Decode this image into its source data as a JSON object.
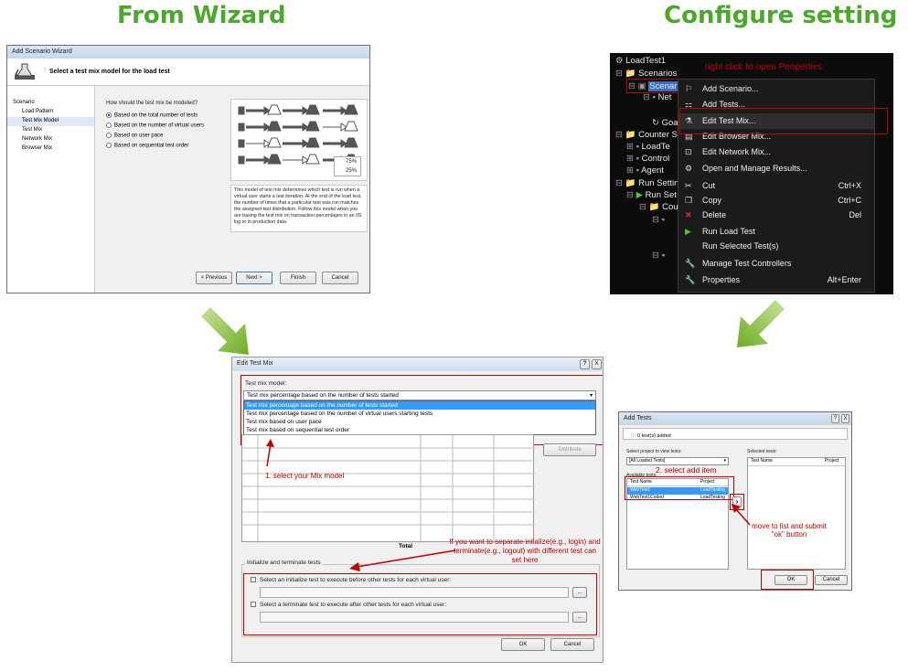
{
  "headings": {
    "left": "From Wizard",
    "right": "Configure setting"
  },
  "wizard": {
    "title": "Add Scenario Wizard",
    "header": "Select a test mix model for the load test",
    "nav": [
      "Scenario",
      "Load Pattern",
      "Test Mix Model",
      "Test Mix",
      "Network Mix",
      "Browser Mix"
    ],
    "selected_nav": "Test Mix Model",
    "question": "How should the test mix be modeled?",
    "options": [
      "Based on the total number of tests",
      "Based on the number of virtual users",
      "Based on user pace",
      "Based on sequential test order"
    ],
    "selected_option": "Based on the total number of tests",
    "legend": [
      "75%",
      "25%"
    ],
    "description": "This model of test mix determines which test is run when a virtual user starts a test iteration. At the end of the load test, the number of times that a particular test was run matches the assigned test distribution. Follow this model when you are basing the test mix on transaction percentages in an IIS log or in production data.",
    "buttons": {
      "previous": "< Previous",
      "next": "Next >",
      "finish": "Finish",
      "cancel": "Cancel"
    }
  },
  "context_panel": {
    "tree": {
      "root": "LoadTest1",
      "scenarios": "Scenarios",
      "scenario": "Scenario",
      "net": "Net",
      "goa": "Goa",
      "counter": "Counter Se",
      "loadte": "LoadTe",
      "control": "Control",
      "agent": "Agent",
      "run_settings": "Run Setting",
      "run_set": "Run Set",
      "cou": "Cou"
    },
    "annotation": "right click to open Peoperties",
    "menu": [
      {
        "label": "Add Scenario...",
        "shortcut": "",
        "icon": "add-scenario-icon"
      },
      {
        "label": "Add Tests...",
        "shortcut": "",
        "icon": "add-tests-icon"
      },
      {
        "label": "Edit Test Mix...",
        "shortcut": "",
        "icon": "flask-icon"
      },
      {
        "label": "Edit Browser Mix...",
        "shortcut": "",
        "icon": "browser-icon"
      },
      {
        "label": "Edit Network Mix...",
        "shortcut": "",
        "icon": "network-icon"
      },
      {
        "label": "Open and Manage Results...",
        "shortcut": "",
        "icon": "results-icon"
      },
      {
        "label": "Cut",
        "shortcut": "Ctrl+X",
        "icon": "cut-icon"
      },
      {
        "label": "Copy",
        "shortcut": "Ctrl+C",
        "icon": "copy-icon"
      },
      {
        "label": "Delete",
        "shortcut": "Del",
        "icon": "delete-icon"
      },
      {
        "label": "Run Load Test",
        "shortcut": "",
        "icon": "run-icon"
      },
      {
        "label": "Run Selected Test(s)",
        "shortcut": "",
        "icon": ""
      },
      {
        "label": "Manage Test Controllers",
        "shortcut": "",
        "icon": "wrench-icon"
      },
      {
        "label": "Properties",
        "shortcut": "Alt+Enter",
        "icon": "wrench-icon"
      }
    ]
  },
  "edit_test_mix": {
    "title": "Edit Test Mix",
    "model_label": "Test mix model:",
    "selected_model": "Test mix percentage based on the number of tests started",
    "dropdown_items": [
      "Test mix percentage based on the number of tests started",
      "Test mix percentage based on the number of virtual users starting tests",
      "Test mix based on user pace",
      "Test mix based on sequential test order"
    ],
    "distribute": "Distribute",
    "total_label": "Total",
    "annotation_mix": "1. select your Mix model",
    "annotation_init": "If you want to separate intialize(e.g., login) and terminate(e.g., logout) with different test can set here",
    "group_label": "Initialize and terminate tests",
    "init_check": "Select an initialize test to execute before other tests for each virtual user:",
    "term_check": "Select a terminate test to execute after other tests for each virtual user:",
    "ok": "OK",
    "cancel": "Cancel",
    "browse": "...",
    "help": "?",
    "close": "X"
  },
  "add_tests": {
    "title": "Add Tests",
    "info": "0 test(s) added",
    "project_label": "Select project to view tests:",
    "project_value": "[All Loaded Tests]",
    "available_label": "Available tests:",
    "selected_label": "Selected tests:",
    "columns": [
      "Test Name",
      "Project"
    ],
    "rows": [
      {
        "name": "WebTest1",
        "project": "LoadTesting"
      },
      {
        "name": "WebTest1Coded",
        "project": "LoadTesting"
      }
    ],
    "annotation_add": "2. select add item",
    "annotation_move": "move to list and submit \"ok\" button",
    "move_button": "›",
    "ok": "OK",
    "cancel": "Cancel",
    "help": "?",
    "close": "X"
  },
  "colors": {
    "heading_green": "#4aa82a",
    "annotation_red": "#c00000",
    "arrow_green": "#7cb82f"
  }
}
